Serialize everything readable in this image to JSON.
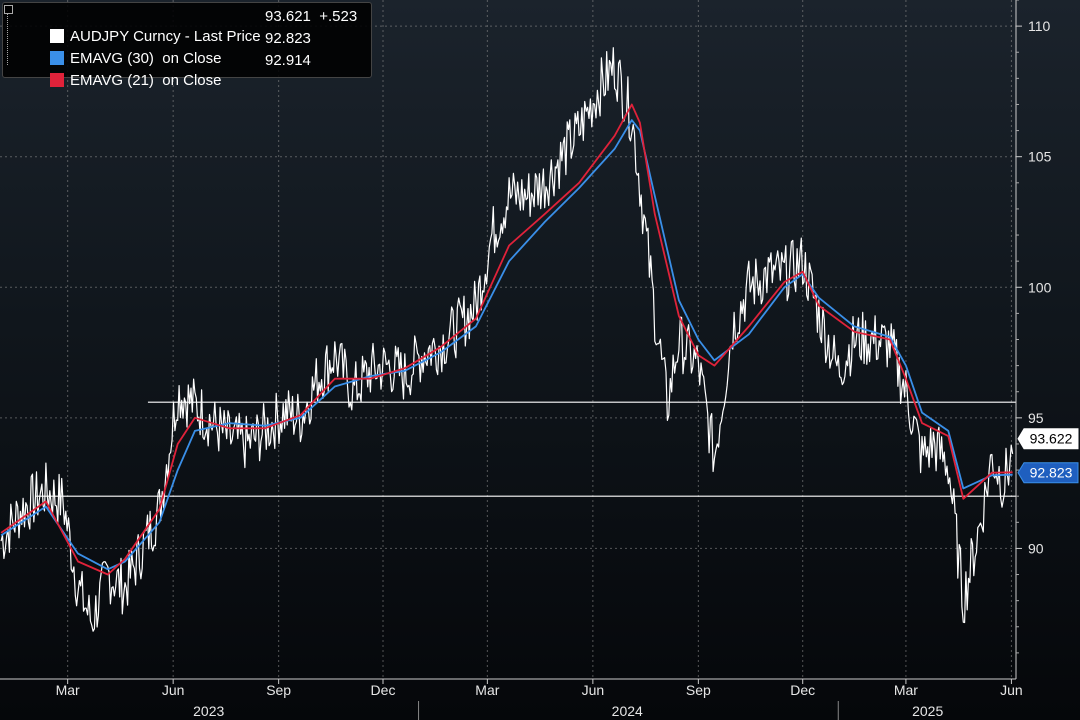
{
  "legend": {
    "main_label": "AUDJPY Curncy - Last Price",
    "main_value": "93.621",
    "main_change": "+.523",
    "ema30_label": "EMAVG (30)  on Close",
    "ema30_value": "92.823",
    "ema21_label": "EMAVG (21)  on Close",
    "ema21_value": "92.914"
  },
  "colors": {
    "price": "#ffffff",
    "ema30": "#3a8fe8",
    "ema21": "#e0223a",
    "grid": "#888888",
    "hline": "#ffffff",
    "background": "#0b1016"
  },
  "chart_data": {
    "type": "line",
    "title": "AUDJPY Curncy",
    "ylim": [
      85,
      111
    ],
    "y_ticks": [
      90,
      95,
      100,
      105,
      110
    ],
    "x_month_labels": [
      "Mar",
      "Jun",
      "Sep",
      "Dec",
      "Mar",
      "Jun",
      "Sep",
      "Dec",
      "Mar",
      "Jun"
    ],
    "x_year_labels": [
      "2023",
      "2024",
      "2025"
    ],
    "x_range": [
      "2023-01-01",
      "2025-06-05"
    ],
    "horizontal_lines": [
      95.6,
      92.0
    ],
    "last_price_tag": "93.622",
    "ema30_tag": "92.823",
    "series": [
      {
        "name": "AUDJPY Curncy - Last Price",
        "dates": [
          "2023-01-02",
          "2023-01-20",
          "2023-02-10",
          "2023-02-25",
          "2023-03-10",
          "2023-03-22",
          "2023-04-05",
          "2023-04-20",
          "2023-05-05",
          "2023-05-20",
          "2023-06-05",
          "2023-06-20",
          "2023-07-05",
          "2023-07-20",
          "2023-08-05",
          "2023-08-20",
          "2023-09-05",
          "2023-09-20",
          "2023-10-05",
          "2023-10-20",
          "2023-11-05",
          "2023-11-20",
          "2023-12-05",
          "2023-12-20",
          "2024-01-05",
          "2024-01-20",
          "2024-02-05",
          "2024-02-20",
          "2024-03-05",
          "2024-03-20",
          "2024-04-05",
          "2024-04-20",
          "2024-05-05",
          "2024-05-20",
          "2024-06-05",
          "2024-06-20",
          "2024-07-05",
          "2024-07-12",
          "2024-07-25",
          "2024-08-05",
          "2024-08-15",
          "2024-09-01",
          "2024-09-15",
          "2024-10-01",
          "2024-10-15",
          "2024-11-01",
          "2024-11-15",
          "2024-12-01",
          "2024-12-15",
          "2025-01-01",
          "2025-01-15",
          "2025-02-01",
          "2025-02-15",
          "2025-03-01",
          "2025-03-15",
          "2025-03-25",
          "2025-04-07",
          "2025-04-20",
          "2025-05-05",
          "2025-05-15",
          "2025-05-25",
          "2025-06-02"
        ],
        "values": [
          90.3,
          91.5,
          92.2,
          91.8,
          88.5,
          87.2,
          89.0,
          88.5,
          90.0,
          91.5,
          96.0,
          95.5,
          94.8,
          94.2,
          94.0,
          94.5,
          95.2,
          95.0,
          96.5,
          97.4,
          96.0,
          96.8,
          97.0,
          96.6,
          97.5,
          97.8,
          98.5,
          99.3,
          102.0,
          103.5,
          103.5,
          104.0,
          105.0,
          106.0,
          107.5,
          108.5,
          106.5,
          104.0,
          99.0,
          95.5,
          98.0,
          97.0,
          93.5,
          98.5,
          100.0,
          100.5,
          100.5,
          101.0,
          99.0,
          96.8,
          98.0,
          98.0,
          97.8,
          96.0,
          93.5,
          94.0,
          93.2,
          88.0,
          91.0,
          93.5,
          92.5,
          93.621
        ]
      },
      {
        "name": "EMAVG (30) on Close",
        "dates": [
          "2023-01-02",
          "2023-02-10",
          "2023-03-10",
          "2023-04-05",
          "2023-04-20",
          "2023-05-20",
          "2023-06-05",
          "2023-06-20",
          "2023-07-20",
          "2023-08-20",
          "2023-09-20",
          "2023-10-20",
          "2023-11-20",
          "2023-12-20",
          "2024-01-20",
          "2024-02-20",
          "2024-03-20",
          "2024-04-20",
          "2024-05-20",
          "2024-06-20",
          "2024-07-05",
          "2024-07-12",
          "2024-07-25",
          "2024-08-15",
          "2024-09-01",
          "2024-09-15",
          "2024-10-15",
          "2024-11-15",
          "2024-12-01",
          "2024-12-15",
          "2025-01-15",
          "2025-02-15",
          "2025-03-01",
          "2025-03-15",
          "2025-04-07",
          "2025-04-20",
          "2025-05-15",
          "2025-06-02"
        ],
        "values": [
          90.5,
          91.6,
          89.8,
          89.2,
          89.5,
          91.0,
          93.0,
          94.5,
          94.8,
          94.7,
          95.0,
          96.2,
          96.6,
          96.8,
          97.5,
          98.5,
          101.0,
          102.5,
          103.8,
          105.3,
          106.4,
          106.0,
          103.5,
          99.5,
          98.0,
          97.2,
          98.2,
          100.0,
          100.5,
          99.6,
          98.5,
          98.1,
          97.0,
          95.2,
          94.5,
          92.3,
          92.8,
          92.823
        ]
      },
      {
        "name": "EMAVG (21) on Close",
        "dates": [
          "2023-01-02",
          "2023-02-10",
          "2023-03-10",
          "2023-04-05",
          "2023-04-20",
          "2023-05-20",
          "2023-06-05",
          "2023-06-20",
          "2023-07-20",
          "2023-08-20",
          "2023-09-20",
          "2023-10-20",
          "2023-11-20",
          "2023-12-20",
          "2024-01-20",
          "2024-02-20",
          "2024-03-20",
          "2024-04-20",
          "2024-05-20",
          "2024-06-20",
          "2024-07-05",
          "2024-07-12",
          "2024-07-25",
          "2024-08-15",
          "2024-09-01",
          "2024-09-15",
          "2024-10-15",
          "2024-11-15",
          "2024-12-01",
          "2024-12-15",
          "2025-01-15",
          "2025-02-15",
          "2025-03-01",
          "2025-03-15",
          "2025-04-07",
          "2025-04-20",
          "2025-05-15",
          "2025-06-02"
        ],
        "values": [
          90.6,
          91.8,
          89.5,
          89.0,
          89.6,
          91.5,
          94.0,
          95.0,
          94.6,
          94.6,
          95.1,
          96.5,
          96.5,
          96.9,
          97.7,
          98.8,
          101.6,
          102.8,
          104.0,
          105.8,
          107.0,
          106.3,
          102.8,
          98.9,
          97.4,
          97.0,
          98.5,
          100.2,
          100.6,
          99.3,
          98.3,
          98.0,
          96.5,
          94.8,
          94.3,
          91.9,
          92.9,
          92.914
        ]
      }
    ]
  }
}
